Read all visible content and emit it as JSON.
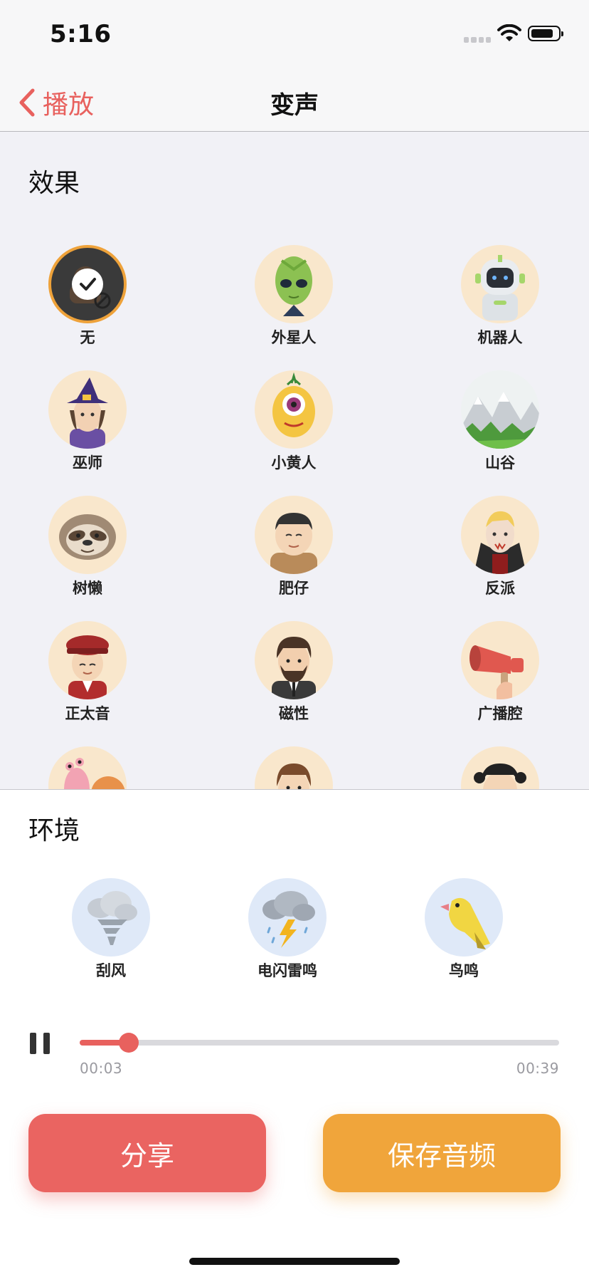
{
  "status": {
    "time": "5:16"
  },
  "nav": {
    "back_label": "播放",
    "title": "变声"
  },
  "effects": {
    "title": "效果",
    "items": [
      {
        "label": "无",
        "icon": "none-icon",
        "selected": true
      },
      {
        "label": "外星人",
        "icon": "alien-icon"
      },
      {
        "label": "机器人",
        "icon": "robot-icon"
      },
      {
        "label": "巫师",
        "icon": "wizard-icon"
      },
      {
        "label": "小黄人",
        "icon": "minion-icon"
      },
      {
        "label": "山谷",
        "icon": "valley-icon"
      },
      {
        "label": "树懒",
        "icon": "sloth-icon"
      },
      {
        "label": "肥仔",
        "icon": "fat-guy-icon"
      },
      {
        "label": "反派",
        "icon": "villain-icon"
      },
      {
        "label": "正太音",
        "icon": "boy-icon"
      },
      {
        "label": "磁性",
        "icon": "magnetic-man-icon"
      },
      {
        "label": "广播腔",
        "icon": "megaphone-icon"
      }
    ]
  },
  "environment": {
    "title": "环境",
    "items": [
      {
        "label": "刮风",
        "icon": "tornado-cloud-icon"
      },
      {
        "label": "电闪雷鸣",
        "icon": "thunderstorm-icon"
      },
      {
        "label": "鸟鸣",
        "icon": "bird-icon"
      }
    ]
  },
  "player": {
    "current": "00:03",
    "total": "00:39",
    "progress": 0.102
  },
  "buttons": {
    "share": "分享",
    "save": "保存音频"
  },
  "colors": {
    "accent_red": "#e8615e",
    "accent_orange": "#f0a53b"
  }
}
